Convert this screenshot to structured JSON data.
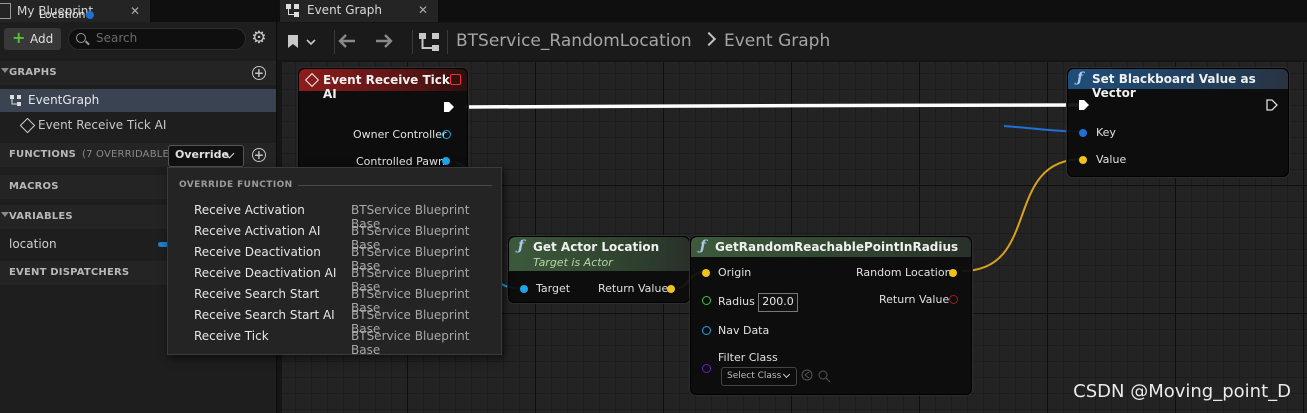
{
  "left_panel": {
    "tab_title": "My Blueprint",
    "tab_close": "✕",
    "add_label": "Add",
    "search_placeholder": "Search",
    "sections": {
      "graphs": "GRAPHS",
      "functions": "FUNCTIONS",
      "functions_count": "(7 OVERRIDABLE)",
      "override_label": "Override",
      "macros": "MACROS",
      "variables": "VARIABLES",
      "event_dispatchers": "EVENT DISPATCHERS"
    },
    "graph_items": [
      "EventGraph",
      "Event Receive Tick AI"
    ],
    "variables": [
      {
        "name": "location",
        "type_color": "#1f7fd1"
      }
    ]
  },
  "override_menu": {
    "header": "OVERRIDE FUNCTION",
    "items": [
      {
        "name": "Receive Activation",
        "source": "BTService Blueprint Base"
      },
      {
        "name": "Receive Activation AI",
        "source": "BTService Blueprint Base"
      },
      {
        "name": "Receive Deactivation",
        "source": "BTService Blueprint Base"
      },
      {
        "name": "Receive Deactivation AI",
        "source": "BTService Blueprint Base"
      },
      {
        "name": "Receive Search Start",
        "source": "BTService Blueprint Base"
      },
      {
        "name": "Receive Search Start AI",
        "source": "BTService Blueprint Base"
      },
      {
        "name": "Receive Tick",
        "source": "BTService Blueprint Base"
      }
    ]
  },
  "graph_tab": {
    "title": "Event Graph",
    "close": "✕"
  },
  "breadcrumb": {
    "blueprint": "BTService_RandomLocation",
    "graph": "Event Graph"
  },
  "nodes": {
    "event_tick": {
      "title": "Event Receive Tick AI",
      "pins": [
        "Owner Controller",
        "Controlled Pawn"
      ]
    },
    "set_blackboard": {
      "title": "Set Blackboard Value as Vector",
      "pins": [
        "Key",
        "Value"
      ]
    },
    "location_var": {
      "title": "Location"
    },
    "get_actor_location": {
      "title": "Get Actor Location",
      "subtitle": "Target is Actor",
      "pins": [
        "Target",
        "Return Value"
      ]
    },
    "random_point": {
      "title": "GetRandomReachablePointInRadius",
      "pins": [
        "Origin",
        "Radius",
        "Nav Data",
        "Filter Class",
        "Random Location",
        "Return Value"
      ],
      "radius_value": "200.0",
      "select_class": "Select Class"
    }
  },
  "colors": {
    "exec": "#ffffff",
    "object_pin": "#1ea4e8",
    "vector_pin": "#f0c21c",
    "float_pin": "#3cc841",
    "bool_pin": "#9a1b1b",
    "class_pin": "#6a1cc8",
    "key_pin": "#1f6fd6"
  },
  "icons": [
    "blueprint-icon",
    "plus-icon",
    "search-icon",
    "gear-icon",
    "event-graph-icon",
    "event-diamond-icon",
    "chevron-down-icon",
    "bookmark-icon",
    "back-arrow-icon",
    "forward-arrow-icon",
    "function-icon",
    "record-icon"
  ],
  "watermark": "CSDN @Moving_point_D"
}
